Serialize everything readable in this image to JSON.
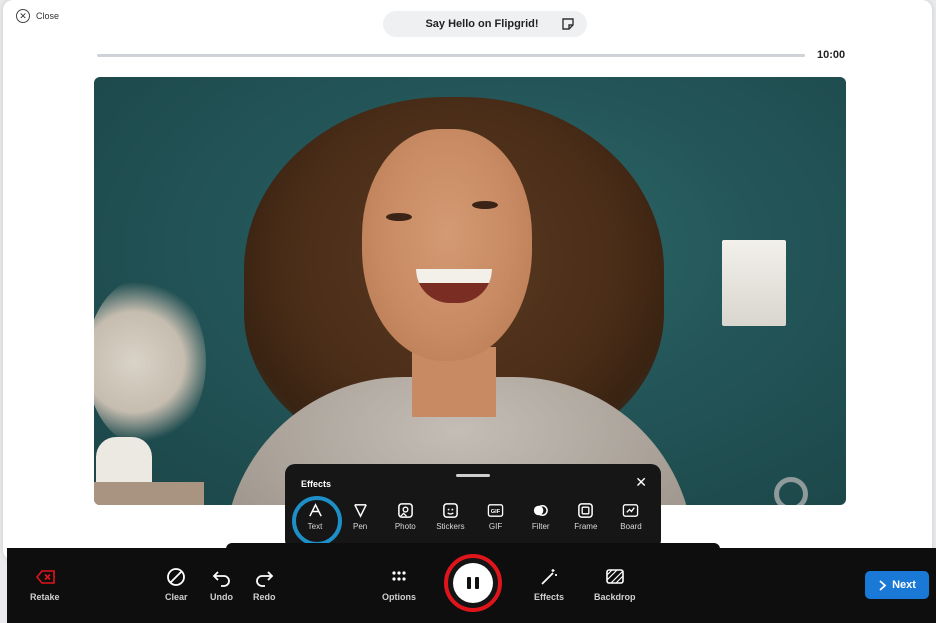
{
  "header": {
    "close_label": "Close",
    "title": "Say Hello on Flipgrid!",
    "timer": "10:00",
    "progress_fraction": 0.0
  },
  "effects_panel": {
    "title": "Effects",
    "items": [
      {
        "label": "Text",
        "icon": "text-icon",
        "active": true
      },
      {
        "label": "Pen",
        "icon": "pen-icon"
      },
      {
        "label": "Photo",
        "icon": "photo-icon"
      },
      {
        "label": "Stickers",
        "icon": "sticker-icon"
      },
      {
        "label": "GIF",
        "icon": "gif-icon",
        "badge": "GIF"
      },
      {
        "label": "Filter",
        "icon": "filter-icon"
      },
      {
        "label": "Frame",
        "icon": "frame-icon"
      },
      {
        "label": "Board",
        "icon": "board-icon"
      }
    ]
  },
  "toolbar": {
    "retake": "Retake",
    "clear": "Clear",
    "undo": "Undo",
    "redo": "Redo",
    "options": "Options",
    "effects": "Effects",
    "backdrop": "Backdrop",
    "next": "Next"
  },
  "colors": {
    "record_ring": "#e0141b",
    "next_button": "#1a78d6",
    "active_effect_ring": "#1e8fc7",
    "retake_icon": "#e0141b"
  }
}
